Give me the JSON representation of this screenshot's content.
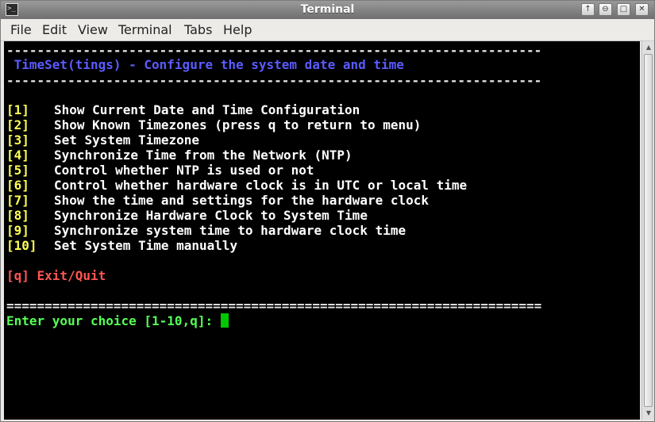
{
  "window": {
    "title": "Terminal",
    "buttons": {
      "help": "↑",
      "minimize": "⊖",
      "maximize": "□",
      "close": "✕"
    }
  },
  "menubar": {
    "file": "File",
    "edit": "Edit",
    "view": "View",
    "terminal": "Terminal",
    "tabs": "Tabs",
    "help": "Help"
  },
  "terminal": {
    "rule_dash": "----------------------------------------------------------------------",
    "header": " TimeSet(tings) - Configure the system date and time",
    "menu": [
      {
        "key": "[1]",
        "label": "Show Current Date and Time Configuration"
      },
      {
        "key": "[2]",
        "label": "Show Known Timezones (press q to return to menu)"
      },
      {
        "key": "[3]",
        "label": "Set System Timezone"
      },
      {
        "key": "[4]",
        "label": "Synchronize Time from the Network (NTP)"
      },
      {
        "key": "[5]",
        "label": "Control whether NTP is used or not"
      },
      {
        "key": "[6]",
        "label": "Control whether hardware clock is in UTC or local time"
      },
      {
        "key": "[7]",
        "label": "Show the time and settings for the hardware clock"
      },
      {
        "key": "[8]",
        "label": "Synchronize Hardware Clock to System Time"
      },
      {
        "key": "[9]",
        "label": "Synchronize system time to hardware clock time"
      },
      {
        "key": "[10]",
        "label": "Set System Time manually"
      }
    ],
    "quit": "[q] Exit/Quit",
    "rule_equals": "======================================================================",
    "prompt": "Enter your choice [1-10,q]: "
  },
  "colors": {
    "background": "#000000",
    "header": "#5b5bff",
    "menu_key": "#ffff55",
    "menu_text": "#ffffff",
    "quit": "#ff5555",
    "prompt": "#55ff55",
    "cursor": "#00c800"
  }
}
